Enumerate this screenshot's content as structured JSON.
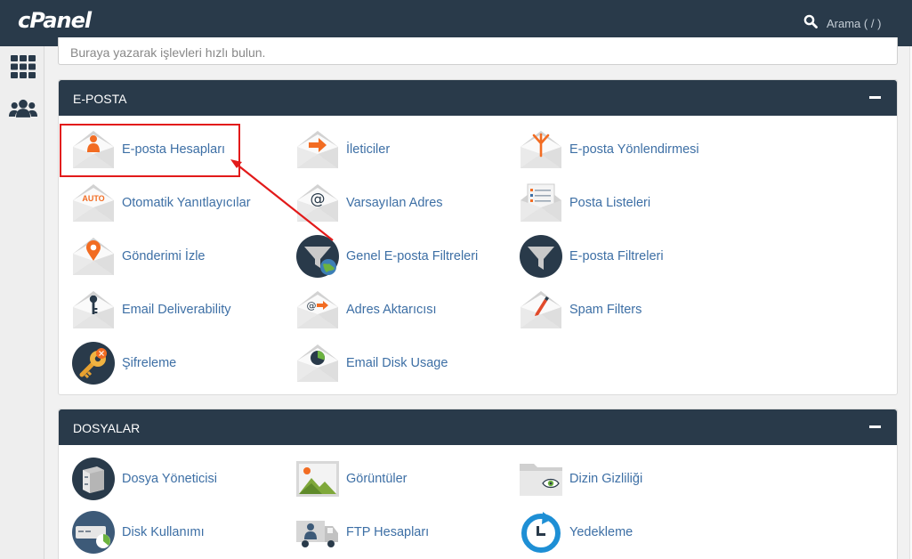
{
  "app": {
    "logo": "cPanel"
  },
  "header": {
    "search_label": "Arama ( / )"
  },
  "quick_search": {
    "placeholder": "Buraya yazarak işlevleri hızlı bulun."
  },
  "sidebar": {
    "items": [
      {
        "icon": "grid-icon"
      },
      {
        "icon": "users-icon"
      }
    ]
  },
  "colors": {
    "header": "#293a4a",
    "link": "#3d6fa5",
    "accent": "#f26c22",
    "highlight": "#e21a1a"
  },
  "sections": [
    {
      "title": "E-POSTA",
      "items": [
        {
          "label": "E-posta Hesapları",
          "icon": "email-accounts-icon"
        },
        {
          "label": "İleticiler",
          "icon": "forwarders-icon"
        },
        {
          "label": "E-posta Yönlendirmesi",
          "icon": "email-routing-icon"
        },
        {
          "label": "Otomatik Yanıtlayıcılar",
          "icon": "autoresponders-icon"
        },
        {
          "label": "Varsayılan Adres",
          "icon": "default-address-icon"
        },
        {
          "label": "Posta Listeleri",
          "icon": "mailing-lists-icon"
        },
        {
          "label": "Gönderimi İzle",
          "icon": "track-delivery-icon"
        },
        {
          "label": "Genel E-posta Filtreleri",
          "icon": "global-email-filters-icon"
        },
        {
          "label": "E-posta Filtreleri",
          "icon": "email-filters-icon"
        },
        {
          "label": "Email Deliverability",
          "icon": "email-deliverability-icon"
        },
        {
          "label": "Adres Aktarıcısı",
          "icon": "address-importer-icon"
        },
        {
          "label": "Spam Filters",
          "icon": "spam-filters-icon"
        },
        {
          "label": "Şifreleme",
          "icon": "encryption-icon"
        },
        {
          "label": "Email Disk Usage",
          "icon": "email-disk-usage-icon"
        }
      ]
    },
    {
      "title": "DOSYALAR",
      "items": [
        {
          "label": "Dosya Yöneticisi",
          "icon": "file-manager-icon"
        },
        {
          "label": "Görüntüler",
          "icon": "images-icon"
        },
        {
          "label": "Dizin Gizliliği",
          "icon": "directory-privacy-icon"
        },
        {
          "label": "Disk Kullanımı",
          "icon": "disk-usage-icon"
        },
        {
          "label": "FTP Hesapları",
          "icon": "ftp-accounts-icon"
        },
        {
          "label": "Yedekleme",
          "icon": "backup-icon"
        }
      ]
    }
  ]
}
